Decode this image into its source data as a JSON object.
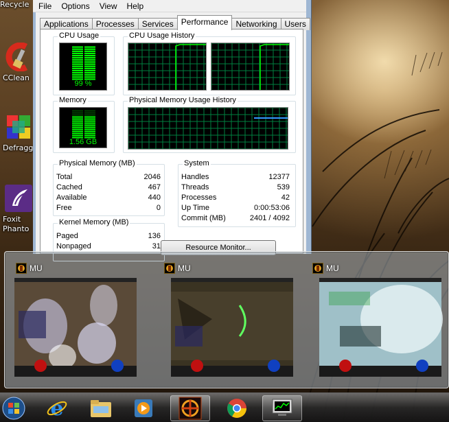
{
  "desktop": {
    "icons": [
      {
        "label": "Recycle",
        "icon": "recycle-bin-icon"
      },
      {
        "label": "CClean",
        "icon": "ccleaner-icon"
      },
      {
        "label": "Defragg",
        "icon": "defraggler-icon"
      },
      {
        "label": "Foxit",
        "label2": "Phanto",
        "icon": "foxit-phantom-icon"
      }
    ]
  },
  "taskmgr": {
    "menu": [
      "File",
      "Options",
      "View",
      "Help"
    ],
    "tabs": [
      "Applications",
      "Processes",
      "Services",
      "Performance",
      "Networking",
      "Users"
    ],
    "active_tab": "Performance",
    "cpu_usage": {
      "title": "CPU Usage",
      "value": "99 %",
      "percent": 99
    },
    "cpu_history": {
      "title": "CPU Usage History"
    },
    "memory": {
      "title": "Memory",
      "value": "1.56 GB",
      "percent": 76
    },
    "mem_history": {
      "title": "Physical Memory Usage History"
    },
    "physical_memory": {
      "title": "Physical Memory (MB)",
      "rows": [
        {
          "label": "Total",
          "value": "2046"
        },
        {
          "label": "Cached",
          "value": "467"
        },
        {
          "label": "Available",
          "value": "440"
        },
        {
          "label": "Free",
          "value": "0"
        }
      ]
    },
    "system": {
      "title": "System",
      "rows": [
        {
          "label": "Handles",
          "value": "12377"
        },
        {
          "label": "Threads",
          "value": "539"
        },
        {
          "label": "Processes",
          "value": "42"
        },
        {
          "label": "Up Time",
          "value": "0:00:53:06"
        },
        {
          "label": "Commit (MB)",
          "value": "2401 / 4092"
        }
      ]
    },
    "kernel_memory": {
      "title": "Kernel Memory (MB)",
      "rows": [
        {
          "label": "Paged",
          "value": "136"
        },
        {
          "label": "Nonpaged",
          "value": "31"
        }
      ]
    },
    "resource_monitor_label": "Resource Monitor..."
  },
  "preview": {
    "windows": [
      {
        "title": "MU",
        "icon": "mu-game-icon"
      },
      {
        "title": "MU",
        "icon": "mu-game-icon"
      },
      {
        "title": "MU",
        "icon": "mu-game-icon"
      }
    ]
  },
  "taskbar": {
    "items": [
      {
        "icon": "start-orb-icon"
      },
      {
        "icon": "internet-explorer-icon"
      },
      {
        "icon": "file-explorer-icon"
      },
      {
        "icon": "media-player-icon"
      },
      {
        "icon": "mu-game-icon",
        "active": true
      },
      {
        "icon": "chrome-icon"
      },
      {
        "icon": "task-manager-icon"
      }
    ]
  },
  "colors": {
    "graph_green": "#00ff00",
    "grid_green": "#008040",
    "memory_line": "#3399ff"
  }
}
